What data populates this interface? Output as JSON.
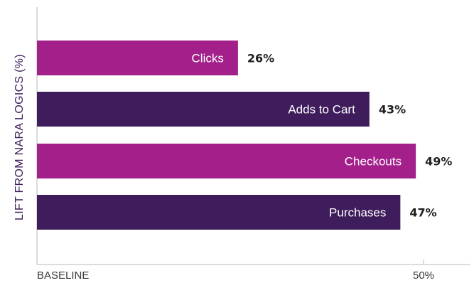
{
  "chart_data": {
    "type": "bar",
    "orientation": "horizontal",
    "categories": [
      "Clicks",
      "Adds to Cart",
      "Checkouts",
      "Purchases"
    ],
    "values": [
      26,
      43,
      49,
      47
    ],
    "value_labels": [
      "26%",
      "43%",
      "49%",
      "47%"
    ],
    "bar_colors": [
      "#a3208a",
      "#3f1d5c",
      "#a3208a",
      "#3f1d5c"
    ],
    "title": "",
    "xlabel": "",
    "ylabel": "LIFT FROM NARA LOGICS (%)",
    "xlim": [
      0,
      50
    ],
    "x_ticks": [
      {
        "value": 0,
        "label": "BASELINE"
      },
      {
        "value": 50,
        "label": "50%"
      }
    ],
    "grid": false,
    "legend": "none"
  }
}
